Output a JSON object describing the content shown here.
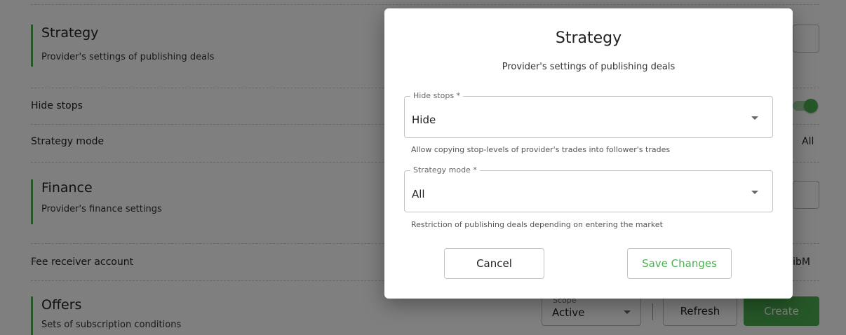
{
  "background": {
    "sections": [
      {
        "title": "Strategy",
        "subtitle": "Provider's settings of publishing deals"
      },
      {
        "title": "Finance",
        "subtitle": "Provider's finance settings"
      },
      {
        "title": "Offers",
        "subtitle": "Sets of subscription conditions"
      }
    ],
    "rows": {
      "hide_stops": "Hide stops",
      "strategy_mode": "Strategy mode",
      "strategy_mode_value": "All",
      "fee_receiver": "Fee receiver account",
      "fee_receiver_value": "c ibM"
    },
    "offers": {
      "scope_label": "Scope",
      "scope_value": "Active",
      "refresh_label": "Refresh",
      "create_label": "Create"
    }
  },
  "modal": {
    "title": "Strategy",
    "subtitle": "Provider's settings of publishing deals",
    "fields": [
      {
        "label": "Hide stops *",
        "value": "Hide",
        "helper": "Allow copying stop-levels of provider's trades into follower's trades"
      },
      {
        "label": "Strategy mode *",
        "value": "All",
        "helper": "Restriction of publishing deals depending on entering the market"
      }
    ],
    "cancel_label": "Cancel",
    "save_label": "Save Changes"
  },
  "colors": {
    "accent": "#4caf50",
    "overlay": "rgba(0,0,0,0.5)"
  }
}
